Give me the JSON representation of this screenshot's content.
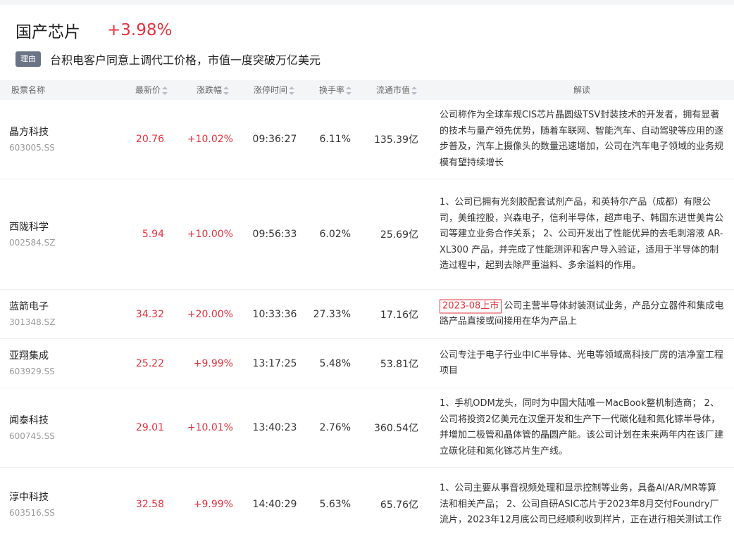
{
  "header": {
    "title": "国产芯片",
    "change": "+3.98%"
  },
  "reason": {
    "badge": "理由",
    "text": "台积电客户同意上调代工价格，市值一度突破万亿美元"
  },
  "columns": {
    "name": "股票名称",
    "price": "最新价",
    "pct": "涨跌幅",
    "time": "涨停时间",
    "turnover": "换手率",
    "cap": "流通市值",
    "desc": "解读"
  },
  "rows": [
    {
      "name": "晶方科技",
      "code": "603005.SS",
      "price": "20.76",
      "pct": "+10.02%",
      "time": "09:36:27",
      "turnover": "6.11%",
      "cap": "135.39亿",
      "tag": "",
      "desc": "公司称作为全球车规CIS芯片晶圆级TSV封装技术的开发者，拥有显著的技术与量产领先优势，随着车联网、智能汽车、自动驾驶等应用的逐步普及，汽车上摄像头的数量迅速增加，公司在汽车电子领域的业务规模有望持续增长"
    },
    {
      "name": "西陇科学",
      "code": "002584.SZ",
      "price": "5.94",
      "pct": "+10.00%",
      "time": "09:56:33",
      "turnover": "6.02%",
      "cap": "25.69亿",
      "tag": "",
      "desc": "1、公司已拥有光刻胶配套试剂产品，和英特尔产品（成都）有限公司，美维控股，兴森电子，信利半导体，超声电子、韩国东进世美肯公司等建立业务合作关系； 2、公司开发出了性能优异的去毛刺溶液 AR-XL300 产品，并完成了性能测评和客户导入验证，适用于半导体的制造过程中，起到去除严重溢料、多余溢料的作用。"
    },
    {
      "name": "蓝箭电子",
      "code": "301348.SZ",
      "price": "34.32",
      "pct": "+20.00%",
      "time": "10:33:36",
      "turnover": "27.33%",
      "cap": "17.16亿",
      "tag": "2023-08上市",
      "desc": "公司主营半导体封装测试业务，产品分立器件和集成电路产品直接或间接用在华为产品上"
    },
    {
      "name": "亚翔集成",
      "code": "603929.SS",
      "price": "25.22",
      "pct": "+9.99%",
      "time": "13:17:25",
      "turnover": "5.48%",
      "cap": "53.81亿",
      "tag": "",
      "desc": "公司专注于电子行业中IC半导体、光电等领域高科技厂房的洁净室工程项目"
    },
    {
      "name": "闻泰科技",
      "code": "600745.SS",
      "price": "29.01",
      "pct": "+10.01%",
      "time": "13:40:23",
      "turnover": "2.76%",
      "cap": "360.54亿",
      "tag": "",
      "desc": "1、手机ODM龙头，同时为中国大陆唯一MacBook整机制造商； 2、公司将投资2亿美元在汉堡开发和生产下一代碳化硅和氮化镓半导体，并增加二极管和晶体管的晶圆产能。该公司计划在未来两年内在该厂建立碳化硅和氮化镓芯片生产线。"
    },
    {
      "name": "淳中科技",
      "code": "603516.SS",
      "price": "32.58",
      "pct": "+9.99%",
      "time": "14:40:29",
      "turnover": "5.63%",
      "cap": "65.76亿",
      "tag": "",
      "desc": "1、公司主要从事音视频处理和显示控制等业务，具备AI/AR/MR等算法和相关产品； 2、公司自研ASIC芯片于2023年8月交付Foundry厂流片，2023年12月底公司已经顺利收到样片，正在进行相关测试工作"
    }
  ]
}
